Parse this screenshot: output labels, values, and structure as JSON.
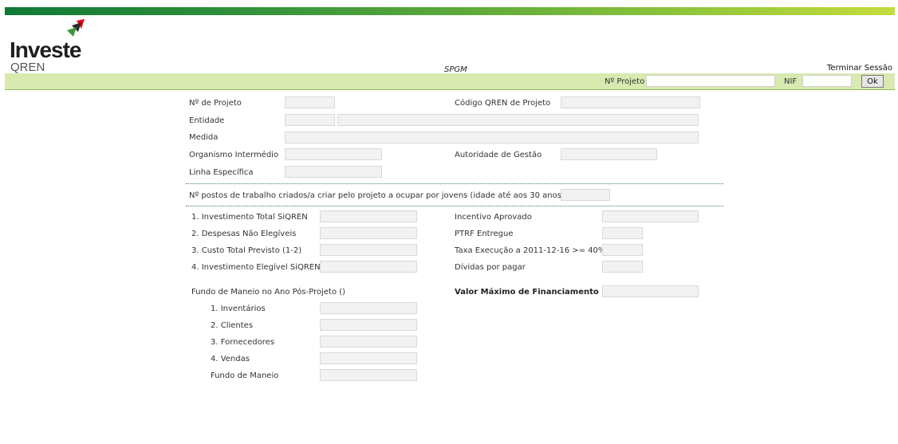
{
  "logo": {
    "word": "Investe",
    "sub": "QREN"
  },
  "header": {
    "app_title": "SPGM",
    "logout_label": "Terminar Sessão"
  },
  "search": {
    "project_label": "Nº Projeto",
    "project_value": "",
    "nif_label": "NIF",
    "nif_value": "",
    "ok_label": "Ok"
  },
  "project": {
    "num_label": "Nº de Projeto",
    "qren_code_label": "Código QREN de Projeto",
    "entity_label": "Entidade",
    "measure_label": "Medida",
    "intermediate_label": "Organismo Intermédio",
    "management_label": "Autoridade de Gestão",
    "line_label": "Linha Específica"
  },
  "jobs": {
    "label": "Nº postos de trabalho criados/a criar pelo projeto a ocupar por jovens (idade até aos 30 anos)"
  },
  "investment": {
    "total_label": "1. Investimento Total SiQREN",
    "non_eligible_label": "2. Despesas Não Elegíveis",
    "total_cost_label": "3. Custo Total Previsto (1-2)",
    "eligible_label": "4. Investimento Elegível SiQREN",
    "approved_incentive_label": "Incentivo Aprovado",
    "ptrf_label": "PTRF Entregue",
    "execution_label": "Taxa Execução a 2011-12-16 >= 40%",
    "debts_label": "Dívidas por pagar"
  },
  "working_capital": {
    "title": "Fundo de Maneio no Ano Pós-Projeto ()",
    "inventory_label": "1. Inventários",
    "clients_label": "2. Clientes",
    "suppliers_label": "3. Fornecedores",
    "sales_label": "4. Vendas",
    "total_label": "Fundo de Maneio",
    "max_financing_label": "Valor Máximo de Financiamento"
  },
  "colors": {
    "brand_dark": "#0f7a36",
    "brand_light": "#c4dc3c",
    "band": "#d8eab0"
  }
}
